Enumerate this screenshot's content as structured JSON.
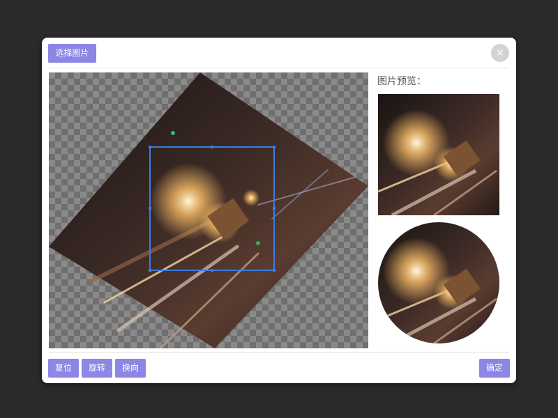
{
  "toolbar": {
    "choose_image": "选择图片",
    "close_symbol": "×"
  },
  "preview": {
    "title": "图片预览："
  },
  "footer": {
    "reset": "复位",
    "rotate": "旋转",
    "flip": "换向",
    "confirm": "确定"
  },
  "colors": {
    "accent": "#8d86e5",
    "crop_border": "#3b7de0",
    "backdrop": "#2a2a2a"
  }
}
